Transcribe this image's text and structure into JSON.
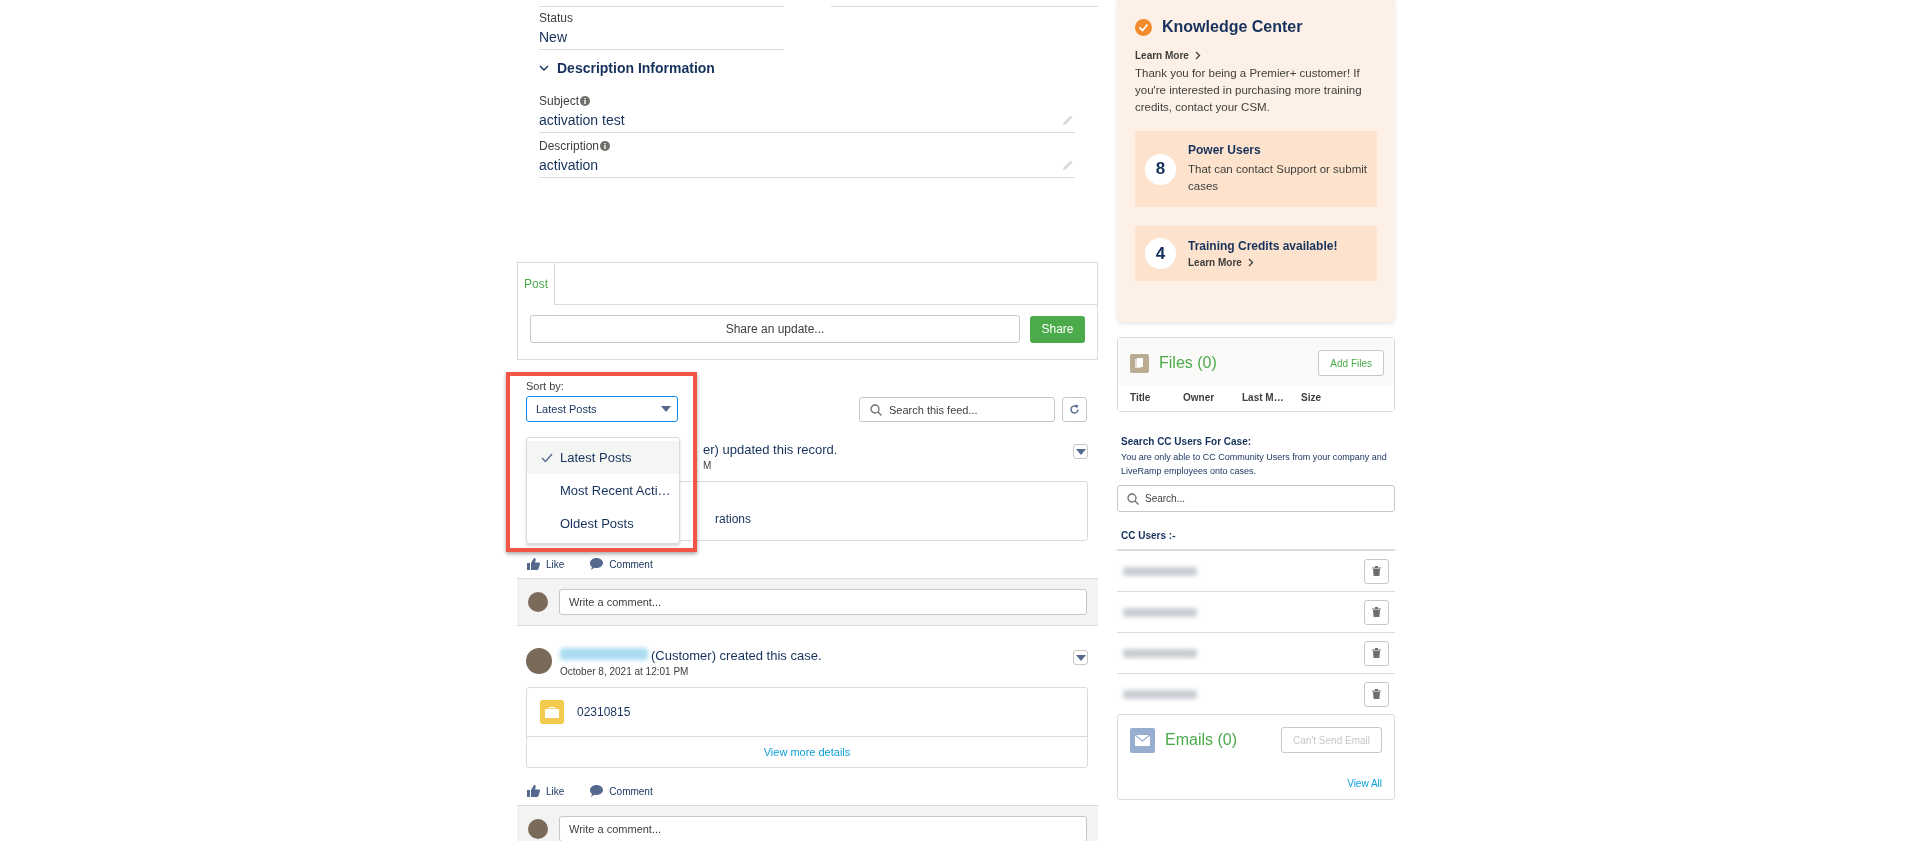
{
  "record": {
    "fields": [
      {
        "label": "Status",
        "value": "New",
        "info": false,
        "editable": false
      }
    ],
    "section": {
      "title": "Description Information",
      "expanded": true,
      "fields": [
        {
          "label": "Subject",
          "value": "activation test",
          "info": true,
          "editable": true
        },
        {
          "label": "Description",
          "value": "activation",
          "info": true,
          "editable": true
        }
      ]
    }
  },
  "publisher": {
    "tabs": [
      {
        "label": "Post",
        "selected": true
      }
    ],
    "placeholder": "Share an update...",
    "button": "Share"
  },
  "feed": {
    "sort_label": "Sort by:",
    "sort_value": "Latest Posts",
    "sort_open": true,
    "sort_options": [
      {
        "label": "Latest Posts",
        "selected": true
      },
      {
        "label": "Most Recent Acti…",
        "selected": false
      },
      {
        "label": "Oldest Posts",
        "selected": false
      }
    ],
    "search_placeholder": "Search this feed...",
    "posts": [
      {
        "kind": "update",
        "header": "er) updated this record.",
        "time": "M",
        "attachment": "rations",
        "actions": [
          "Like",
          "Comment"
        ],
        "comment_placeholder": "Write a comment..."
      },
      {
        "kind": "created",
        "header": "(Customer) created this case.",
        "time": "October 8, 2021 at 12:01 PM",
        "attachment": "02310815",
        "details_link": "View more details",
        "actions": [
          "Like",
          "Comment"
        ],
        "comment_placeholder": "Write a comment..."
      }
    ]
  },
  "knowledge": {
    "title": "Knowledge Center",
    "learn_more": "Learn More",
    "message": "Thank you for being a Premier+ customer! If you're interested in purchasing more training credits, contact your CSM.",
    "stats": [
      {
        "kind": "text",
        "number": "8",
        "title": "Power Users",
        "text": "That can contact Support or submit cases"
      },
      {
        "kind": "link",
        "number": "4",
        "title": "Training Credits available!",
        "text": "Learn More"
      }
    ]
  },
  "files": {
    "title": "Files (0)",
    "button": "Add Files",
    "columns": [
      "Title",
      "Owner",
      "Last M…",
      "Size"
    ]
  },
  "cc": {
    "title": "Search CC Users For Case:",
    "note": "You are only able to CC Community Users from your company and LiveRamp employees onto cases.",
    "search_placeholder": "Search...",
    "list_title": "CC Users :-",
    "users": [
      {
        "kind": "blurred"
      },
      {
        "kind": "blurred"
      },
      {
        "kind": "blurred"
      },
      {
        "kind": "blurred"
      }
    ]
  },
  "emails": {
    "title": "Emails (0)",
    "button": "Can't Send Email",
    "button_disabled": true,
    "link": "View All"
  }
}
